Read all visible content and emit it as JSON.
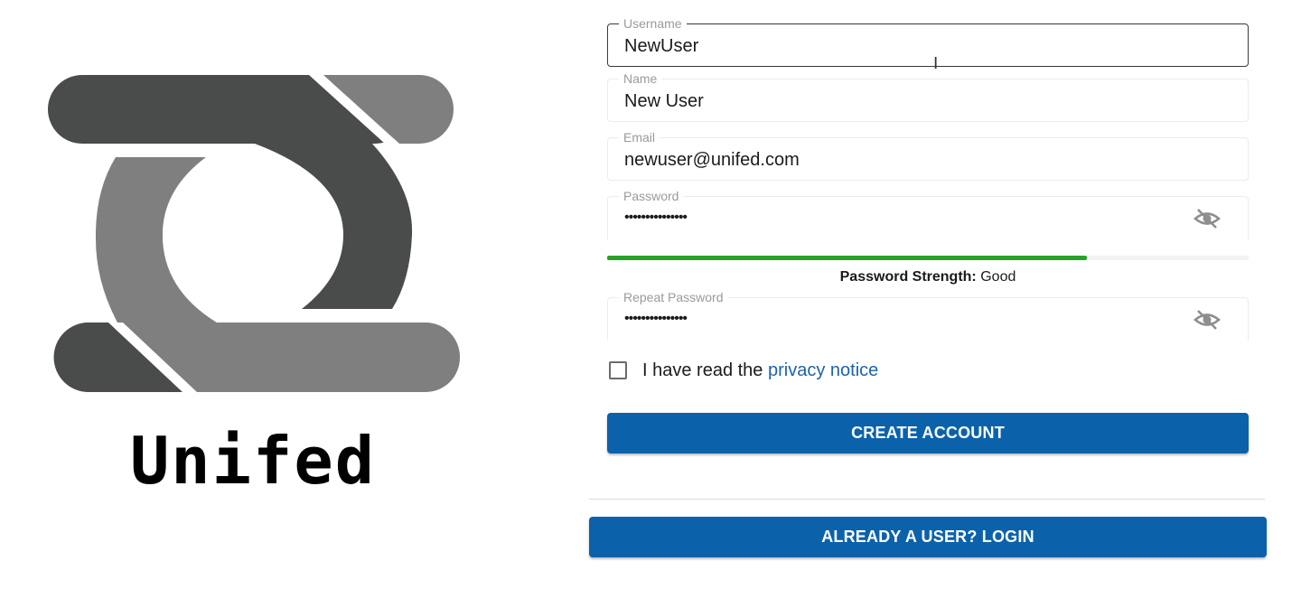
{
  "brand": {
    "name": "Unifed"
  },
  "form": {
    "username": {
      "label": "Username",
      "value": "NewUser"
    },
    "name": {
      "label": "Name",
      "value": "New User"
    },
    "email": {
      "label": "Email",
      "value": "newuser@unifed.com"
    },
    "password": {
      "label": "Password",
      "value": "•••••••••••••••",
      "visibility_icon": "eye-off-icon"
    },
    "strength": {
      "label": "Password Strength:",
      "value": "Good",
      "fraction": 0.748
    },
    "repeat_password": {
      "label": "Repeat Password",
      "value": "•••••••••••••••",
      "visibility_icon": "eye-off-icon"
    },
    "privacy": {
      "text": "I have read the",
      "link": "privacy notice",
      "checked": false
    },
    "create_button": "CREATE ACCOUNT",
    "login_button": "ALREADY A USER? LOGIN"
  },
  "colors": {
    "primary": "#0b62aa",
    "strength_good": "#27a228",
    "link": "#1e63a8",
    "logo_dark": "#4a4b4b",
    "logo_light": "#7f7f7f"
  }
}
